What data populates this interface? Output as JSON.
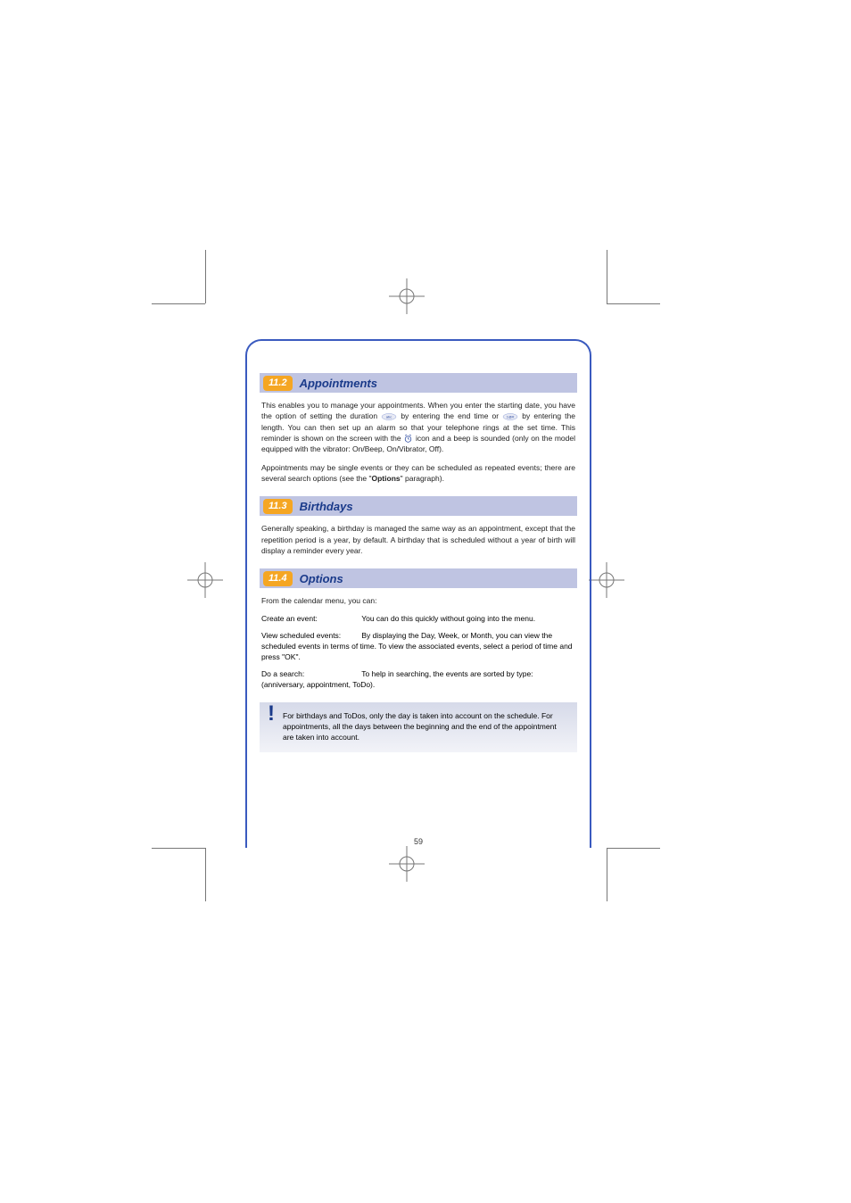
{
  "sections": [
    {
      "num": "11.2",
      "title": "Appointments",
      "paragraphs": [
        {
          "parts": [
            {
              "t": "text",
              "v": "This enables you to manage your appointments. When you enter the starting date, you have the option of setting the duration "
            },
            {
              "t": "key",
              "label": "abc"
            },
            {
              "t": "text",
              "v": " by entering the end time or "
            },
            {
              "t": "key",
              "label": "1@#"
            },
            {
              "t": "text",
              "v": " by entering the length. You can then set up an alarm so that your telephone rings at the set time. This reminder is shown on the screen with the "
            },
            {
              "t": "alarm"
            },
            {
              "t": "text",
              "v": " icon and a beep is sounded (only on the model equipped with the vibrator: On/Beep, On/Vibrator, Off)."
            }
          ]
        },
        {
          "parts": [
            {
              "t": "text",
              "v": "Appointments may be single events or they can be scheduled as repeated events; there are several search options (see the \""
            },
            {
              "t": "bold",
              "v": "Options"
            },
            {
              "t": "text",
              "v": "\" paragraph)."
            }
          ]
        }
      ]
    },
    {
      "num": "11.3",
      "title": "Birthdays",
      "paragraphs": [
        {
          "parts": [
            {
              "t": "text",
              "v": "Generally speaking, a birthday is managed the same way as an appointment, except that the repetition period is a year, by default. A birthday that is scheduled without a year of birth will display a reminder every year."
            }
          ]
        }
      ]
    },
    {
      "num": "11.4",
      "title": "Options",
      "paragraphs": [
        {
          "parts": [
            {
              "t": "text",
              "v": "From the calendar menu, you can:"
            }
          ]
        }
      ],
      "definitions": [
        {
          "term_bold": "Create",
          "term_rest": " an event:",
          "def": "You can do this quickly without going into the menu."
        },
        {
          "term_bold": "View",
          "term_rest": " scheduled events:",
          "def": "By displaying the Day, Week, or Month, you can view the scheduled events in terms of time. To view the associated events, select a period of time and press \"OK\"."
        },
        {
          "term_bold": "Do a search",
          "term_rest": ":",
          "def": "To help in searching, the events are sorted by type: (anniversary, appointment, ToDo)."
        }
      ]
    }
  ],
  "note": "For birthdays and ToDos, only the day is taken into account on the schedule. For appointments, all the days between the beginning and the end of the appointment are taken into account.",
  "pageNumber": "59"
}
